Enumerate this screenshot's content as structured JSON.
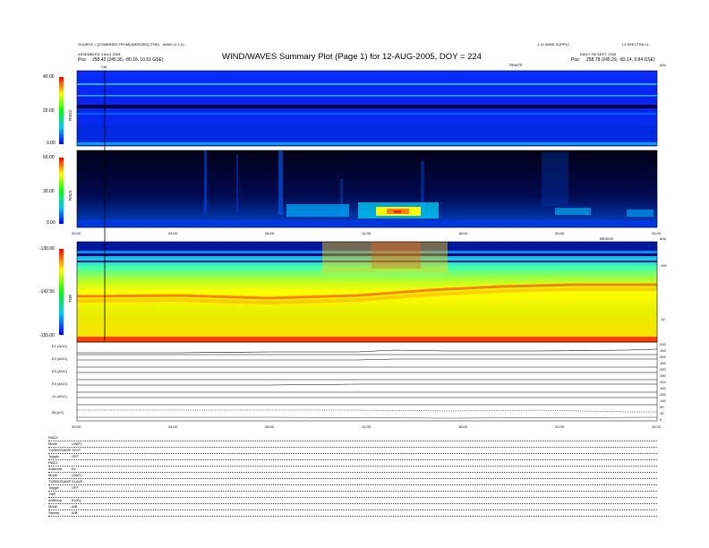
{
  "header": {
    "title": "WIND/WAVES Summary Plot (Page 1) for 12-AUG-2005, DOY = 224",
    "left_line1": "SOURCE = [COMBINED FROM] [MERGED] (TNR) - WIND (V 1.0)",
    "left_line2": "ASSEMBLED 3 AUG 2005",
    "left_pos_label": "Pos:",
    "left_pos_value": "258.43 (245.30, -80.18, 10.51 GSE)",
    "right_line1": "1.10 WIND SUPPLY",
    "right_line2": "L3 SPECTRA v1",
    "right_line3": "DAILY TM SEPT. 2005",
    "right_pos_label": "Pos:",
    "right_pos_value": "258.78 (245.29, -82.14, 9.84 GSE)",
    "marker_label": "Cal",
    "rad1_badge": "TRINITE",
    "rad1_unit": "kHz",
    "tnr_badge": "BRIDGE",
    "tnr_unit": "kHz"
  },
  "panels": {
    "rad2": {
      "label": "RAD2",
      "ticks": [
        "40.00",
        "20.00",
        "0.00"
      ],
      "colors": [
        "#ff0000",
        "#ffff00",
        "#00ff00",
        "#00c8ff",
        "#0000ff"
      ]
    },
    "rad1": {
      "label": "RAD1",
      "ticks": [
        "60.00",
        "30.00",
        "0.00"
      ]
    },
    "tnr": {
      "label": "TNR",
      "ticks": [
        "-130.00",
        "-142.50",
        "-155.00"
      ],
      "right_ticks": [
        "100",
        "10"
      ]
    }
  },
  "time_axis": {
    "ticks": [
      "00:00",
      "04:00",
      "08:00",
      "12:00",
      "16:00",
      "20:00",
      "24:00"
    ]
  },
  "traces": [
    {
      "label": "E1 (AGC)",
      "right": [
        "200",
        "100"
      ]
    },
    {
      "label": "E2 (AGC)",
      "right": [
        "200",
        "100"
      ]
    },
    {
      "label": "E3 (AGC)",
      "right": [
        "200",
        "100"
      ]
    },
    {
      "label": "E4 (AGC)",
      "right": [
        "200",
        "100"
      ]
    },
    {
      "label": "J1 (AGC)",
      "right": [
        "200",
        "100"
      ]
    },
    {
      "label": "|B| (nT)",
      "right": [
        "20",
        "10",
        "0"
      ]
    }
  ],
  "info": [
    {
      "k": "RAD2",
      "v": ""
    },
    {
      "k": "Mode",
      "v": "LIN(F)"
    },
    {
      "k": "TURBOSAMP",
      "v": "TEST"
    },
    {
      "k": "Toggle",
      "v": "OFF"
    },
    {
      "k": "RAD1",
      "v": ""
    },
    {
      "k": "Antenna",
      "v": "Ex"
    },
    {
      "k": "Mode",
      "v": "LIN(F)"
    },
    {
      "k": "TURBOSAMP",
      "v": "SLAVE"
    },
    {
      "k": "Toggle",
      "v": "OFF"
    },
    {
      "k": "TNR",
      "v": ""
    },
    {
      "k": "Antenna",
      "v": "Ex/Ey"
    },
    {
      "k": "Mode",
      "v": "A/B"
    },
    {
      "k": "Sweep",
      "v": "A/B"
    }
  ],
  "chart_data": {
    "type": "heatmap",
    "title": "WIND/WAVES Summary Plot (Page 1) for 12-AUG-2005, DOY = 224",
    "x_axis": {
      "range_hours": [
        0,
        24
      ],
      "ticks": [
        "00:00",
        "04:00",
        "08:00",
        "12:00",
        "16:00",
        "20:00",
        "24:00"
      ]
    },
    "panels": [
      {
        "name": "RAD2",
        "color_range": [
          0,
          40
        ],
        "notable": "narrow-band horizontal lines throughout day"
      },
      {
        "name": "RAD1",
        "color_range": [
          0,
          60
        ],
        "notable": "intense emission ~11:00-15:00 near lowest frequencies"
      },
      {
        "name": "TNR",
        "color_range": [
          -155,
          -130
        ],
        "notable": "plasma line band rising after 12:00"
      }
    ],
    "grid": false
  }
}
